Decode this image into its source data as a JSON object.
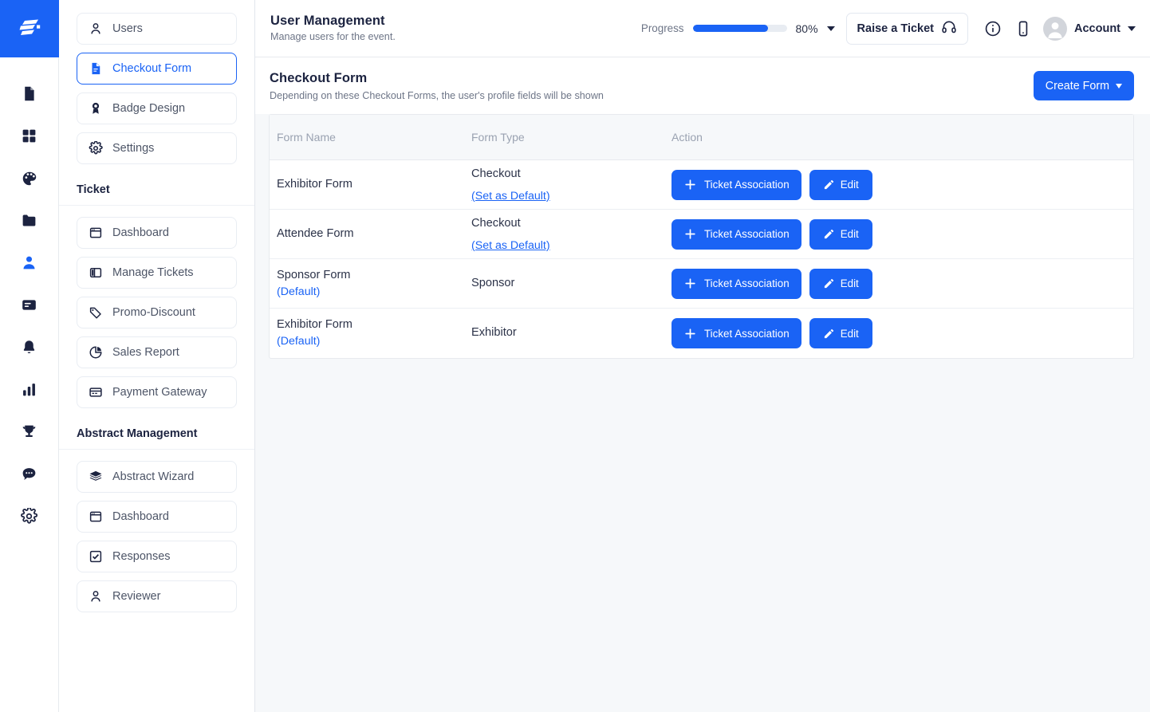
{
  "brand": {
    "logo": "stacked-bars-logo",
    "color": "#1a63f5"
  },
  "rail": {
    "items": [
      {
        "icon": "document-icon",
        "name": "document",
        "active": false
      },
      {
        "icon": "grid-icon",
        "name": "apps",
        "active": false
      },
      {
        "icon": "palette-icon",
        "name": "design",
        "active": false
      },
      {
        "icon": "folder-icon",
        "name": "files",
        "active": false
      },
      {
        "icon": "person-icon",
        "name": "users",
        "active": true
      },
      {
        "icon": "card-icon",
        "name": "content",
        "active": false
      },
      {
        "icon": "bell-icon",
        "name": "notifications",
        "active": false
      },
      {
        "icon": "bar-chart-icon",
        "name": "analytics",
        "active": false
      },
      {
        "icon": "trophy-icon",
        "name": "awards",
        "active": false
      },
      {
        "icon": "chat-icon",
        "name": "messages",
        "active": false
      },
      {
        "icon": "gear-icon",
        "name": "settings",
        "active": false
      }
    ]
  },
  "topbar": {
    "title": "User Management",
    "subtitle": "Manage users for the event.",
    "progress_label": "Progress",
    "progress_value": 80,
    "progress_percent_text": "80%",
    "raise_ticket_label": "Raise a Ticket",
    "account_label": "Account"
  },
  "sidebar": {
    "groups": [
      {
        "heading": null,
        "items": [
          {
            "label": "Users",
            "icon": "person-icon",
            "active": false
          },
          {
            "label": "Checkout Form",
            "icon": "document-icon",
            "active": true
          },
          {
            "label": "Badge Design",
            "icon": "badge-icon",
            "active": false
          },
          {
            "label": "Settings",
            "icon": "gear-icon",
            "active": false
          }
        ]
      },
      {
        "heading": "Ticket",
        "items": [
          {
            "label": "Dashboard",
            "icon": "window-icon",
            "active": false
          },
          {
            "label": "Manage Tickets",
            "icon": "layout-icon",
            "active": false
          },
          {
            "label": "Promo-Discount",
            "icon": "tag-icon",
            "active": false
          },
          {
            "label": "Sales Report",
            "icon": "pie-chart-icon",
            "active": false
          },
          {
            "label": "Payment Gateway",
            "icon": "credit-card-icon",
            "active": false
          }
        ]
      },
      {
        "heading": "Abstract Management",
        "items": [
          {
            "label": "Abstract Wizard",
            "icon": "layers-icon",
            "active": false
          },
          {
            "label": "Dashboard",
            "icon": "window-icon",
            "active": false
          },
          {
            "label": "Responses",
            "icon": "checkbox-icon",
            "active": false
          },
          {
            "label": "Reviewer",
            "icon": "person-icon",
            "active": false
          }
        ]
      }
    ]
  },
  "content": {
    "title": "Checkout Form",
    "subtitle": "Depending on these Checkout Forms, the user's profile fields will be shown",
    "create_button": "Create Form",
    "table": {
      "columns": [
        "Form Name",
        "Form Type",
        "Action"
      ],
      "rows": [
        {
          "form_name": "Exhibitor Form",
          "name_tag": null,
          "form_type": "Checkout",
          "type_link": "(Set as Default)",
          "ticket_association_label": "Ticket Association",
          "edit_label": "Edit"
        },
        {
          "form_name": "Attendee Form",
          "name_tag": null,
          "form_type": "Checkout",
          "type_link": "(Set as Default)",
          "ticket_association_label": "Ticket Association",
          "edit_label": "Edit"
        },
        {
          "form_name": "Sponsor Form",
          "name_tag": "(Default)",
          "form_type": "Sponsor",
          "type_link": null,
          "ticket_association_label": "Ticket Association",
          "edit_label": "Edit"
        },
        {
          "form_name": "Exhibitor Form",
          "name_tag": "(Default)",
          "form_type": "Exhibitor",
          "type_link": null,
          "ticket_association_label": "Ticket Association",
          "edit_label": "Edit"
        }
      ]
    }
  }
}
